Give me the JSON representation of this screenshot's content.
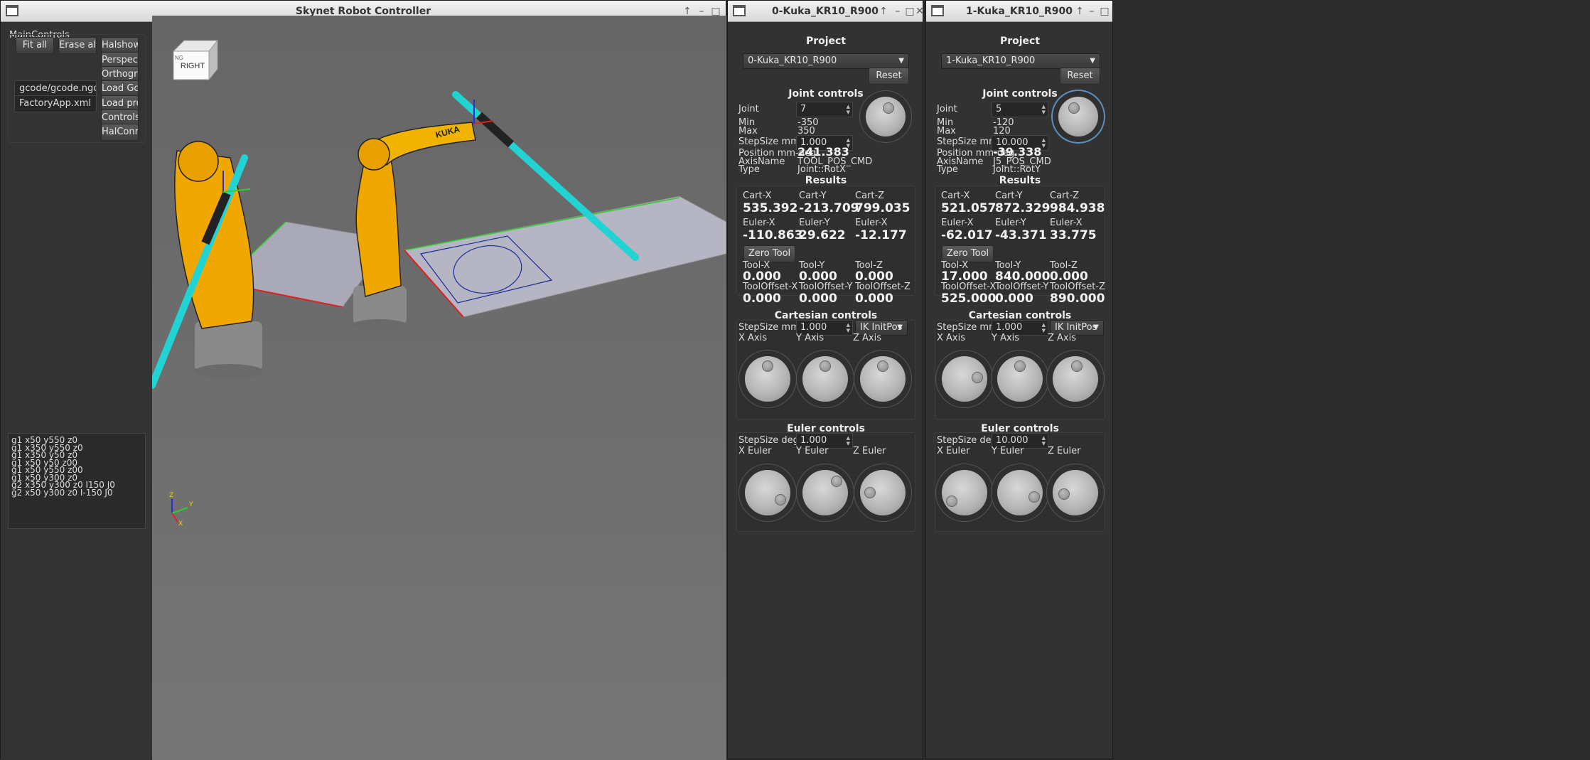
{
  "main_window": {
    "title": "Skynet Robot Controller"
  },
  "main_controls": {
    "group_title": "MainControls",
    "buttons": {
      "fit_all": "Fit all",
      "erase_all": "Erase all",
      "halshow": "Halshow",
      "perspective": "Perspective",
      "orthographic": "Orthographic",
      "load_gcode": "Load Gcode",
      "load_project": "Load project",
      "controls": "Controls",
      "halcontrols": "HalConrols"
    },
    "gcode_path": "gcode/gcode.ngc",
    "project_file": "FactoryApp.xml"
  },
  "gcode_lines": [
    "g1 x50 y550 z0",
    "g1 x350 y550 z0",
    "g1 x350 y50 z0",
    "g1 x50 y50 z00",
    "g1 x50 y550 z00",
    "g1 x50 y300 z0",
    "g2 x350 y300 z0 I150 J0",
    "g2 x50 y300 z0 I-150 J0"
  ],
  "viewport": {
    "view_cube_label": "RIGHT",
    "view_cube_side": "NG",
    "axis_x": "X",
    "axis_y": "Y",
    "axis_z": "Z",
    "robot_brand": "KUKA"
  },
  "panels": [
    {
      "title": "0-Kuka_KR10_R900",
      "project_label": "Project",
      "project_value": "0-Kuka_KR10_R900",
      "reset": "Reset",
      "joint_controls": "Joint controls",
      "joint_label": "Joint",
      "joint_value": "7",
      "min_label": "Min",
      "min_value": "-350",
      "max_label": "Max",
      "max_value": "350",
      "stepsize_label": "StepSize mm",
      "stepsize_value": "1.000",
      "position_label": "Position mm-deg",
      "position_value": "241.383",
      "axisname_label": "AxisName",
      "axisname_value": "TOOL_POS_CMD",
      "type_label": "Type",
      "type_value": "Joint::RotX",
      "results": "Results",
      "cart_x_l": "Cart-X",
      "cart_x": "535.392",
      "cart_y_l": "Cart-Y",
      "cart_y": "-213.709",
      "cart_z_l": "Cart-Z",
      "cart_z": "799.035",
      "eul_x_l": "Euler-X",
      "eul_x": "-110.863",
      "eul_y_l": "Euler-Y",
      "eul_y": "29.622",
      "eul_z_l": "Euler-X",
      "eul_z": "-12.177",
      "zero_tool": "Zero Tool",
      "tool_x_l": "Tool-X",
      "tool_x": "0.000",
      "tool_y_l": "Tool-Y",
      "tool_y": "0.000",
      "tool_z_l": "Tool-Z",
      "tool_z": "0.000",
      "to_x_l": "ToolOffset-X",
      "to_x": "0.000",
      "to_y_l": "ToolOffset-Y",
      "to_y": "0.000",
      "to_z_l": "ToolOffset-Z",
      "to_z": "0.000",
      "cartesian_controls": "Cartesian controls",
      "cart_step_label": "StepSize mm",
      "cart_step_value": "1.000",
      "ik_mode": "IK InitPos",
      "x_axis": "X Axis",
      "y_axis": "Y Axis",
      "z_axis": "Z Axis",
      "euler_controls": "Euler controls",
      "euler_step_label": "StepSize degrees",
      "euler_step_value": "1.000",
      "x_euler": "X Euler",
      "y_euler": "Y Euler",
      "z_euler": "Z Euler"
    },
    {
      "title": "1-Kuka_KR10_R900",
      "project_label": "Project",
      "project_value": "1-Kuka_KR10_R900",
      "reset": "Reset",
      "joint_controls": "Joint controls",
      "joint_label": "Joint",
      "joint_value": "5",
      "min_label": "Min",
      "min_value": "-120",
      "max_label": "Max",
      "max_value": "120",
      "stepsize_label": "StepSize mm",
      "stepsize_value": "10.000",
      "position_label": "Position mm-deg",
      "position_value": "-39.338",
      "axisname_label": "AxisName",
      "axisname_value": "J5_POS_CMD",
      "type_label": "Type",
      "type_value": "Joint::RotY",
      "results": "Results",
      "cart_x_l": "Cart-X",
      "cart_x": "521.057",
      "cart_y_l": "Cart-Y",
      "cart_y": "872.329",
      "cart_z_l": "Cart-Z",
      "cart_z": "984.938",
      "eul_x_l": "Euler-X",
      "eul_x": "-62.017",
      "eul_y_l": "Euler-Y",
      "eul_y": "-43.371",
      "eul_z_l": "Euler-X",
      "eul_z": "33.775",
      "zero_tool": "Zero Tool",
      "tool_x_l": "Tool-X",
      "tool_x": "17.000",
      "tool_y_l": "Tool-Y",
      "tool_y": "840.000",
      "tool_z_l": "Tool-Z",
      "tool_z": "0.000",
      "to_x_l": "ToolOffset-X",
      "to_x": "525.000",
      "to_y_l": "ToolOffset-Y",
      "to_y": "0.000",
      "to_z_l": "ToolOffset-Z",
      "to_z": "890.000",
      "cartesian_controls": "Cartesian controls",
      "cart_step_label": "StepSize mm",
      "cart_step_value": "1.000",
      "ik_mode": "IK InitPos",
      "x_axis": "X Axis",
      "y_axis": "Y Axis",
      "z_axis": "Z Axis",
      "euler_controls": "Euler controls",
      "euler_step_label": "StepSize degrees",
      "euler_step_value": "10.000",
      "x_euler": "X Euler",
      "y_euler": "Y Euler",
      "z_euler": "Z Euler"
    }
  ],
  "colors": {
    "robot": "#f0a800",
    "tool": "#22d3d3",
    "plane": "#b9b9c8",
    "background": "#6e6e6e",
    "accent_ring": "#5a8fc0"
  }
}
